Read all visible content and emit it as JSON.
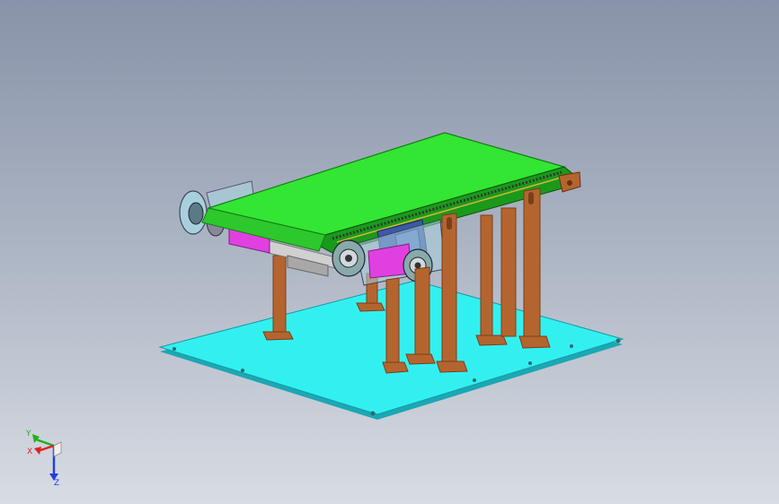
{
  "viewport": {
    "background_top": "#8893a9",
    "background_bottom": "#d8dce3"
  },
  "model": {
    "colors": {
      "base_plate": "#33f0f0",
      "base_plate_edge": "#1aa8b4",
      "belt": "#33e633",
      "belt_edge": "#1a9a1a",
      "legs": "#b4652f",
      "legs_dark": "#7a3f1a",
      "motor": "#e040e0",
      "frame": "#c8c8c8",
      "bracket": "#3a5aa8",
      "guard": "#a8d0dc"
    }
  },
  "triad": {
    "x_label": "X",
    "y_label": "Y",
    "z_label": "Z",
    "x_color": "#e02020",
    "y_color": "#20b020",
    "z_color": "#2040e0"
  }
}
